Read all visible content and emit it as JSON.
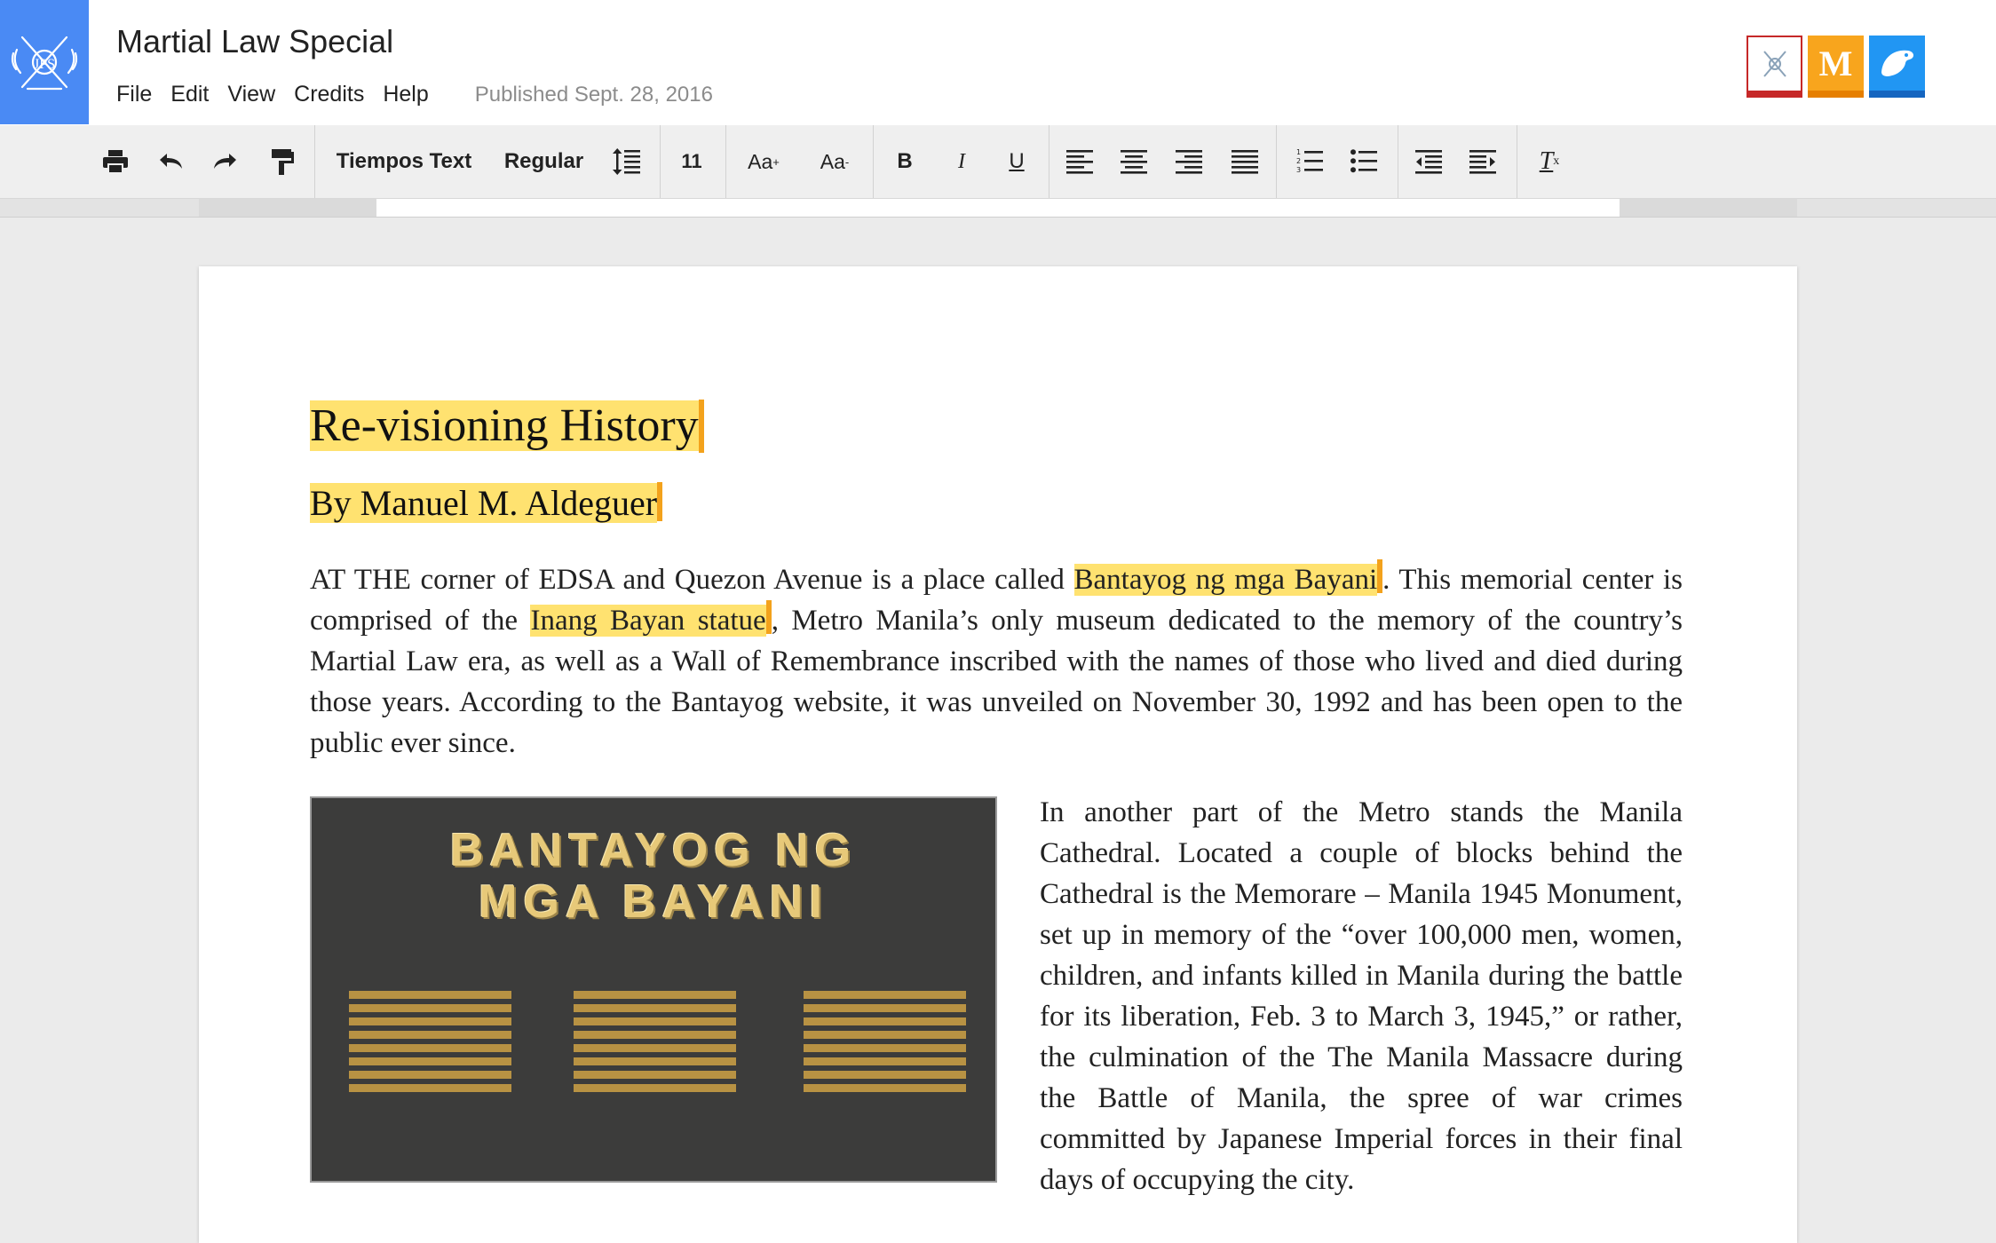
{
  "app": {
    "doc_title": "Martial Law Special",
    "published": "Published Sept. 28, 2016",
    "logo_icon": "crest-logo-icon",
    "badges": [
      {
        "name": "crossed-flags-icon",
        "color": "#c62828"
      },
      {
        "name": "m-logo",
        "text": "M",
        "color": "#f8a51d"
      },
      {
        "name": "eagle-icon",
        "color": "#2196f3"
      }
    ]
  },
  "menu": [
    "File",
    "Edit",
    "View",
    "Credits",
    "Help"
  ],
  "toolbar": {
    "font_family": "Tiempos Text",
    "font_style": "Regular",
    "font_size": "11",
    "increase_size": "Aa",
    "increase_sup": "+",
    "decrease_size": "Aa",
    "decrease_sup": "-",
    "bold": "B",
    "italic": "I",
    "underline": "U",
    "clear_format": "T",
    "clear_sub": "x"
  },
  "article": {
    "title": "Re-visioning History",
    "byline": "By Manuel M. Aldeguer",
    "p1_a": "AT THE corner of EDSA and Quezon Avenue is a place called ",
    "p1_hl1": "Bantayog ng mga Bayani",
    "p1_b": ". This memorial center is comprised of the ",
    "p1_hl2": "Inang Bayan statue",
    "p1_c": ", Metro Manila’s only museum dedicated to the memory of the country’s Martial Law era, as well as a Wall of Remembrance inscribed with the names of those who lived and died during those years. According to the Bantayog website, it was unveiled on November 30, 1992 and has been open to the public ever since.",
    "p2": "In another part of the Metro stands the Manila Cathedral. Located a couple of blocks behind the Cathedral is the Memorare – Manila 1945 Monument, set up in memory of the “over 100,000 men, women, children, and infants killed in Manila during the battle for its liberation, Feb. 3 to March 3, 1945,” or rather, the culmination of the The Manila Massacre during the Battle of Manila, the spree of war crimes committed by Japanese Imperial forces in their final days of occupying the city.",
    "figure_line1": "BANTAYOG NG",
    "figure_line2": "MGA BAYANI"
  },
  "colors": {
    "accent": "#4a8af4",
    "highlight": "#ffe270",
    "cursor": "#f3a21c",
    "figure_bg": "#3c3c3b",
    "figure_gold": "#e7c979"
  }
}
